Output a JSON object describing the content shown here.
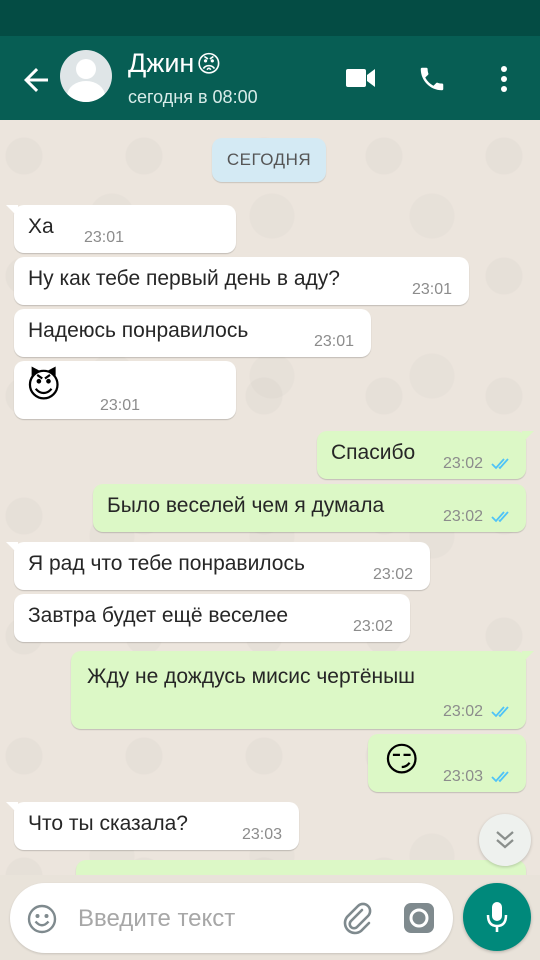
{
  "header": {
    "contact_name": "Джин",
    "contact_emoji": "😡",
    "last_seen": "сегодня в 08:00"
  },
  "chat": {
    "date_label": "СЕГОДНЯ",
    "messages": [
      {
        "direction": "in",
        "text": "Ха",
        "time": "23:01"
      },
      {
        "direction": "in",
        "text": "Ну как тебе первый день в аду?",
        "time": "23:01"
      },
      {
        "direction": "in",
        "text": "Надеюсь понравилось",
        "time": "23:01"
      },
      {
        "direction": "in",
        "text": "😈",
        "time": "23:01"
      },
      {
        "direction": "out",
        "text": "Спасибо",
        "time": "23:02",
        "read": true
      },
      {
        "direction": "out",
        "text": "Было веселей чем я думала",
        "time": "23:02",
        "read": true
      },
      {
        "direction": "in",
        "text": "Я рад что тебе понравилось",
        "time": "23:02"
      },
      {
        "direction": "in",
        "text": "Завтра будет ещё веселее",
        "time": "23:02"
      },
      {
        "direction": "out",
        "text": "Жду не дождусь мисис чертёныш",
        "time": "23:02",
        "read": true
      },
      {
        "direction": "out",
        "text": "😏",
        "time": "23:03",
        "read": true
      },
      {
        "direction": "in",
        "text": "Что ты сказала?",
        "time": "23:03"
      }
    ]
  },
  "composer": {
    "placeholder": "Введите текст"
  },
  "colors": {
    "header": "#075e54",
    "status_bar": "#044c44",
    "outgoing_bubble": "#dcf8c6",
    "incoming_bubble": "#ffffff",
    "read_ticks": "#4fc3f7",
    "mic_button": "#00897b"
  },
  "icons": [
    "back-arrow-icon",
    "avatar-placeholder-icon",
    "video-call-icon",
    "phone-icon",
    "more-vert-icon",
    "double-check-icon",
    "chevron-double-down-icon",
    "emoji-icon",
    "paperclip-icon",
    "camera-icon",
    "microphone-icon"
  ]
}
